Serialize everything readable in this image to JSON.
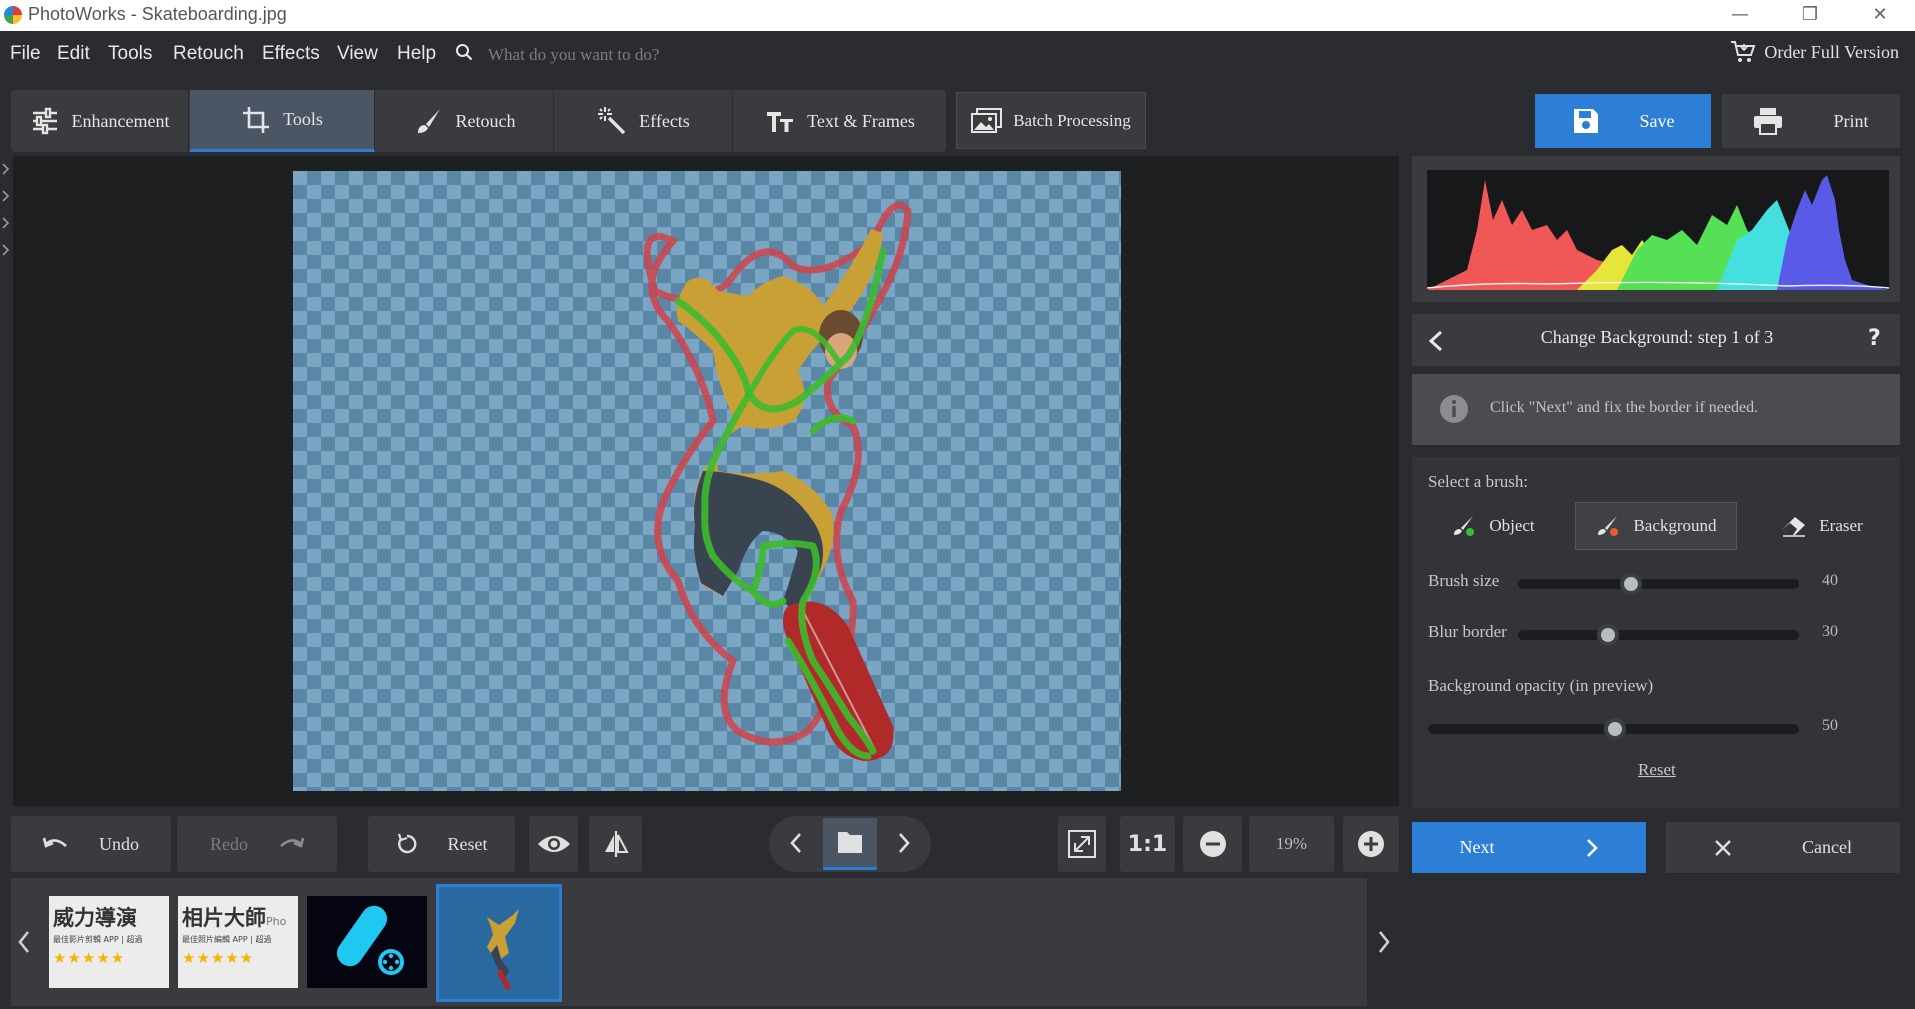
{
  "window": {
    "title": "PhotoWorks - Skateboarding.jpg",
    "minimize": "—",
    "restore": "❐",
    "close": "✕"
  },
  "menu": {
    "items": [
      "File",
      "Edit",
      "Tools",
      "Retouch",
      "Effects",
      "View",
      "Help"
    ],
    "search_placeholder": "What do you want to do?",
    "order_label": "Order Full Version"
  },
  "tabs": [
    {
      "label": "Enhancement",
      "icon": "sliders-icon"
    },
    {
      "label": "Tools",
      "icon": "crop-icon"
    },
    {
      "label": "Retouch",
      "icon": "brush-icon"
    },
    {
      "label": "Effects",
      "icon": "magic-wand-icon"
    },
    {
      "label": "Text & Frames",
      "icon": "text-icon"
    }
  ],
  "active_tab": "Tools",
  "batch_label": "Batch Processing",
  "save_label": "Save",
  "print_label": "Print",
  "step": {
    "title": "Change Background: step 1 of 3",
    "help": "?",
    "info": "Click \"Next\" and fix the border if needed."
  },
  "brush": {
    "select_label": "Select a brush:",
    "options": [
      "Object",
      "Background",
      "Eraser"
    ],
    "selected": "Background",
    "sliders": [
      {
        "label": "Brush size",
        "value": "40",
        "fraction": 0.4
      },
      {
        "label": "Blur border",
        "value": "30",
        "fraction": 0.3
      },
      {
        "label": "Background opacity (in preview)",
        "value": "50",
        "fraction": 0.5
      }
    ],
    "reset_link": "Reset"
  },
  "actions": {
    "next_label": "Next",
    "cancel_label": "Cancel"
  },
  "bottom": {
    "undo_label": "Undo",
    "redo_label": "Redo",
    "reset_label": "Reset",
    "one_to_one": "1:1",
    "zoom": "19%"
  },
  "thumbnails": [
    {
      "title": "威力導演",
      "subtitle": "最佳影片剪輯 APP | 超過",
      "stars": "★★★★★"
    },
    {
      "title": "相片大師",
      "extra": "Pho",
      "subtitle": "最佳照片編輯 APP | 超過",
      "stars": "★★★★★"
    }
  ],
  "colors": {
    "accent": "#2c7ed6",
    "mask_object": "#3dbb2e",
    "mask_background": "#d0434b"
  }
}
